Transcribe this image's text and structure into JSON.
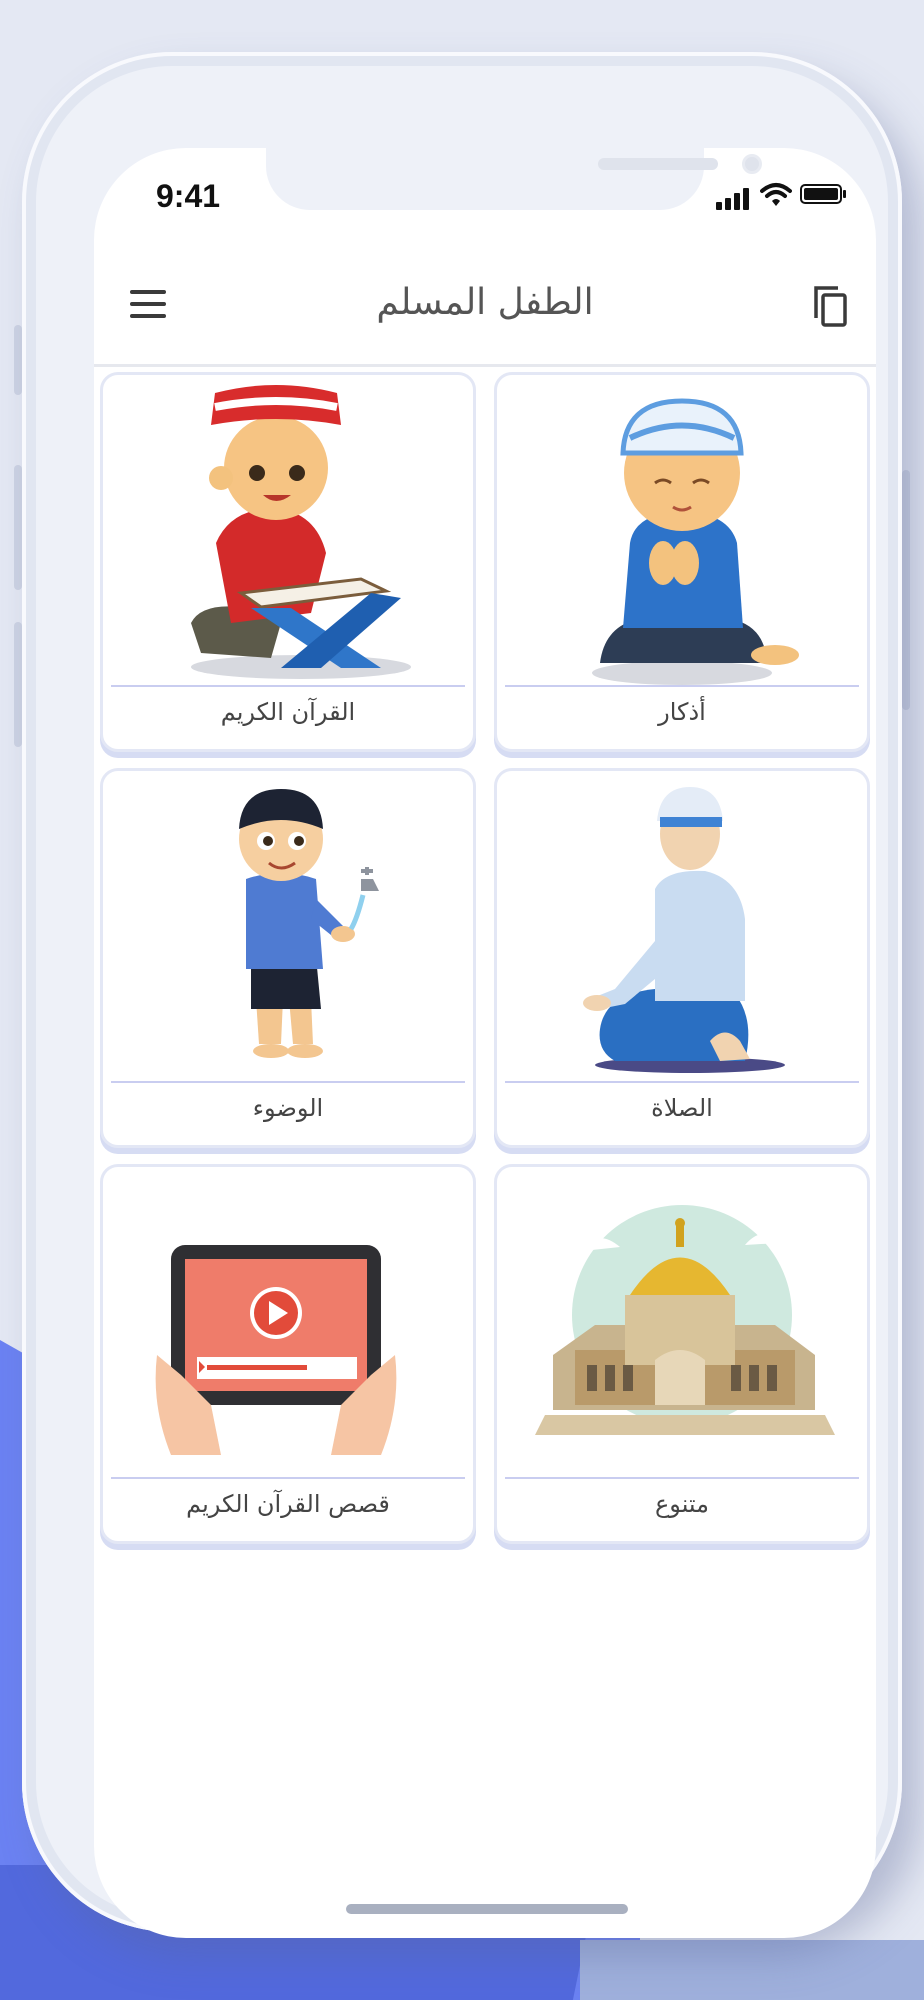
{
  "status_bar": {
    "time": "9:41"
  },
  "app_bar": {
    "title": "الطفل المسلم",
    "menu_icon": "hamburger-menu-icon",
    "copy_icon": "copy-icon"
  },
  "categories": [
    {
      "label": "أذكار",
      "illustration": "praying-boy-illustration"
    },
    {
      "label": "القرآن الكريم",
      "illustration": "boy-reading-quran-illustration"
    },
    {
      "label": "الصلاة",
      "illustration": "sitting-prayer-illustration"
    },
    {
      "label": "الوضوء",
      "illustration": "boy-ablution-illustration"
    },
    {
      "label": "متنوع",
      "illustration": "dome-of-the-rock-illustration"
    },
    {
      "label": "قصص القرآن الكريم",
      "illustration": "tablet-video-illustration"
    }
  ],
  "colors": {
    "background": "#e4e8f3",
    "accent_blue": "#6b82f2",
    "card_border": "#e3e7f5",
    "label_text": "#444444"
  }
}
